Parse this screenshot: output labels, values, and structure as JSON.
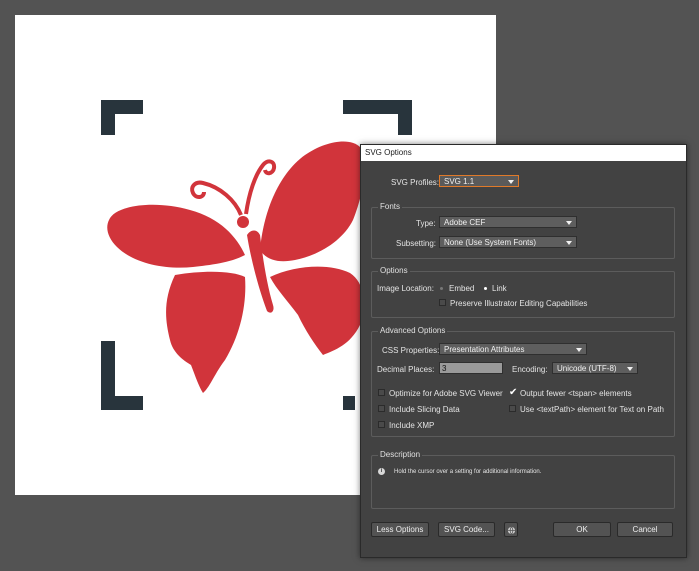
{
  "dialog": {
    "title": "SVG Options",
    "svg_profiles": {
      "label": "SVG Profiles:",
      "value": "SVG 1.1"
    },
    "fonts": {
      "group_label": "Fonts",
      "type_label": "Type:",
      "type_value": "Adobe CEF",
      "subsetting_label": "Subsetting:",
      "subsetting_value": "None (Use System Fonts)"
    },
    "options": {
      "group_label": "Options",
      "image_location_label": "Image Location:",
      "embed_label": "Embed",
      "link_label": "Link",
      "selected_location": "Link",
      "preserve_label": "Preserve Illustrator Editing Capabilities"
    },
    "advanced": {
      "group_label": "Advanced Options",
      "css_label": "CSS Properties:",
      "css_value": "Presentation Attributes",
      "decimal_label": "Decimal Places:",
      "decimal_value": "3",
      "encoding_label": "Encoding:",
      "encoding_value": "Unicode (UTF-8)",
      "optimize_label": "Optimize for Adobe SVG Viewer",
      "output_fewer_label": "Output fewer <tspan> elements",
      "slicing_label": "Include Slicing Data",
      "textpath_label": "Use <textPath> element for Text on Path",
      "xmp_label": "Include XMP"
    },
    "description": {
      "group_label": "Description",
      "text": "Hold the cursor over a setting for additional information."
    },
    "buttons": {
      "less_options": "Less Options",
      "svg_code": "SVG Code...",
      "ok": "OK",
      "cancel": "Cancel"
    }
  },
  "icons": {
    "globe": "globe-icon",
    "info": "info-icon",
    "checkmark": "✔"
  },
  "colors": {
    "butterfly": "#d1343b",
    "brackets": "#28343c",
    "dialog_bg": "#424242",
    "focus": "#e07a2a"
  }
}
